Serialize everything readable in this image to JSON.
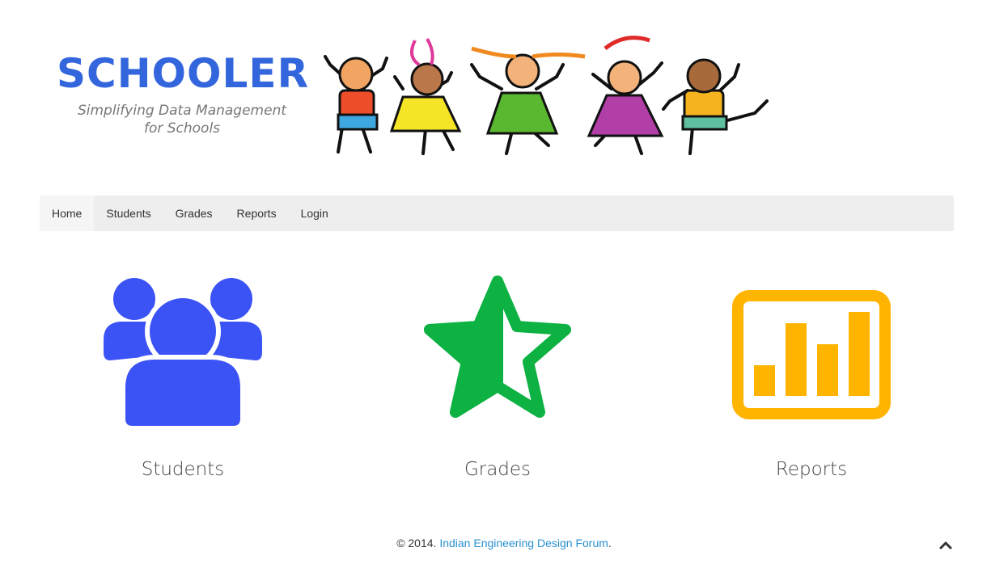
{
  "brand": {
    "title": "SCHOOLER",
    "tagline_line1": "Simplifying Data Management",
    "tagline_line2": "for Schools"
  },
  "nav": {
    "items": [
      {
        "label": "Home",
        "active": true
      },
      {
        "label": "Students"
      },
      {
        "label": "Grades"
      },
      {
        "label": "Reports"
      },
      {
        "label": "Login"
      }
    ]
  },
  "features": [
    {
      "label": "Students",
      "icon": "users-icon",
      "color": "#3b52f5"
    },
    {
      "label": "Grades",
      "icon": "half-star-icon",
      "color": "#0db243"
    },
    {
      "label": "Reports",
      "icon": "bar-chart-icon",
      "color": "#ffb400"
    }
  ],
  "footer": {
    "prefix": "© 2014. ",
    "link_text": "Indian Engineering Design Forum",
    "suffix": "."
  },
  "colors": {
    "accent": "#3366dd",
    "nav_bg": "#eeeeee",
    "link": "#2a8fd0"
  }
}
